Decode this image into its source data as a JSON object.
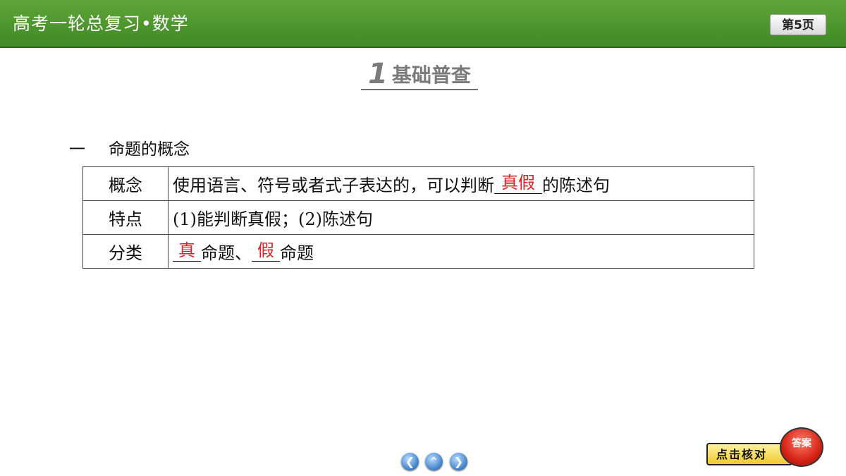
{
  "header": {
    "course_title": "高考一轮总复习•数学",
    "page_label": "第5页"
  },
  "section": {
    "number": "1",
    "title": "基础普查"
  },
  "subheading": {
    "marker": "一",
    "text": "命题的概念"
  },
  "table": {
    "rows": [
      {
        "head": "概念",
        "pre": "使用语言、符号或者式子表达的，可以判断",
        "blank": "真假",
        "post": "的陈述句"
      },
      {
        "head": "特点",
        "text": "(1)能判断真假；(2)陈述句"
      },
      {
        "head": "分类",
        "blank1": "真",
        "mid": "命题、",
        "blank2": "假",
        "post": "命题"
      }
    ]
  },
  "nav": {
    "prev_icon": "chevron-left-icon",
    "home_icon": "chevron-up-icon",
    "next_icon": "chevron-right-icon"
  },
  "answer_widget": {
    "check_label": "点击核对",
    "answer_label": "答案"
  },
  "colors": {
    "header_green": "#4a9a2e",
    "answer_red": "#d22222",
    "nav_blue": "#3c7fc8"
  }
}
